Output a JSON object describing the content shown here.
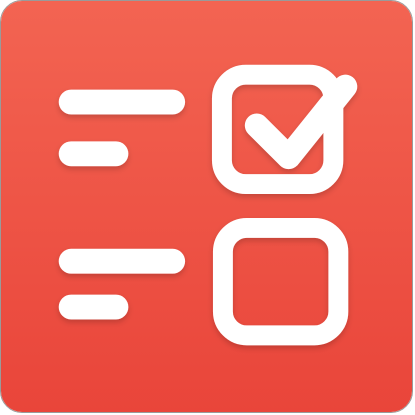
{
  "icon": {
    "name": "checklist-icon",
    "colors": {
      "background_top": "#F36452",
      "background_bottom": "#E9453A",
      "foreground": "#FFFFFF"
    },
    "items": [
      {
        "label_bars": 2,
        "checked": true
      },
      {
        "label_bars": 2,
        "checked": false
      }
    ]
  }
}
